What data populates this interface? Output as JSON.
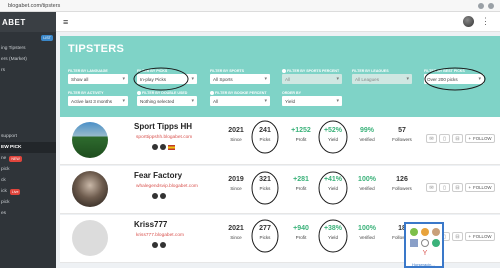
{
  "browser": {
    "url": "blogabet.com/tipsters"
  },
  "sidebar": {
    "logo": "ABET",
    "items": [
      {
        "label": "",
        "badge": "LIST",
        "badge_color": "blue"
      },
      {
        "label": "ing Tipsters"
      },
      {
        "label": "ers (Market)"
      },
      {
        "label": "rs"
      },
      {
        "label": ""
      },
      {
        "label": ""
      },
      {
        "label": ""
      },
      {
        "label": ""
      },
      {
        "label": ""
      },
      {
        "label": " support"
      },
      {
        "label": "EW PICK",
        "active": true
      },
      {
        "label": "ne",
        "badge": "NEW",
        "badge_color": "red"
      },
      {
        "label": "pick"
      },
      {
        "label": "ck"
      },
      {
        "label": "ick",
        "badge": "Live",
        "badge_color": "red"
      },
      {
        "label": "pick"
      },
      {
        "label": "es"
      }
    ]
  },
  "banner": {
    "title": "TIPSTERS",
    "filters": [
      {
        "label": "FILTER BY LANGUAGE",
        "value": "Show all"
      },
      {
        "label": "FILTER BY PICKS",
        "value": "In-play Picks"
      },
      {
        "label": "FILTER BY SPORTS",
        "value": "All Sports"
      },
      {
        "label": "FILTER BY SPORTS PERCENT",
        "value": "All",
        "dim": true,
        "info": true
      },
      {
        "label": "FILTER BY LEAGUES",
        "value": "All Leagues",
        "dim": true
      },
      {
        "label": "FILTER BY BEST PICKS",
        "value": "Over 200 picks"
      },
      {
        "label": "FILTER BY ACTIVITY",
        "value": "Active last 3 months"
      },
      {
        "label": "FILTER BY DOUBLE USED",
        "value": "Nothing selected",
        "info": true
      },
      {
        "label": "FILTER BY BOOKIE PERCENT",
        "value": "All",
        "info": true
      },
      {
        "label": "ORDER BY",
        "value": "Yield"
      }
    ]
  },
  "stat_labels": {
    "since": "Since",
    "picks": "Picks",
    "profit": "Profit",
    "yield": "Yield",
    "verified": "Verified",
    "followers": "Followers",
    "follow": "FOLLOW"
  },
  "tipsters": [
    {
      "name": "Sport Tipps HH",
      "url": "sporttippshh.blogabet.com",
      "since": "2021",
      "picks": "241",
      "profit": "+1252",
      "yield": "+52%",
      "verified": "99%",
      "followers": "57"
    },
    {
      "name": "Fear Factory",
      "url": "whalegendsvip.blogabet.com",
      "since": "2019",
      "picks": "321",
      "profit": "+281",
      "yield": "+41%",
      "verified": "100%",
      "followers": "126"
    },
    {
      "name": "Kriss777",
      "url": "kriss777.blogabet.com",
      "since": "2021",
      "picks": "277",
      "profit": "+940",
      "yield": "+38%",
      "verified": "100%",
      "followers": "18"
    }
  ],
  "popup": {
    "link": "Horseracin..."
  },
  "colors": {
    "banner": "#7fd3c7",
    "green": "#3bb27a",
    "annotation": "#1a1a1a",
    "popup_border": "#3a78c9"
  }
}
